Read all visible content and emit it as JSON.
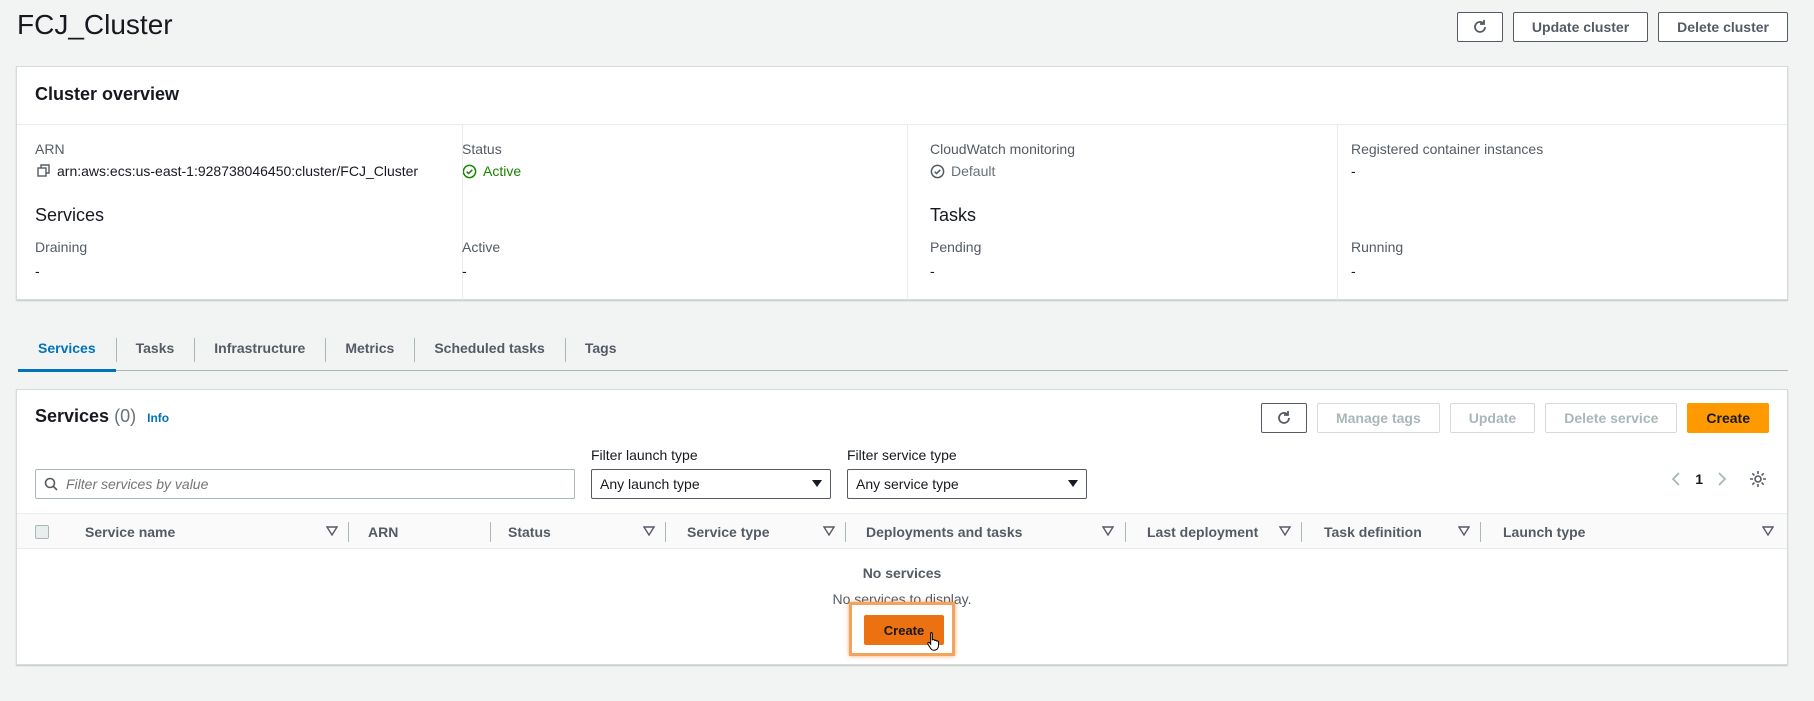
{
  "header": {
    "title": "FCJ_Cluster",
    "update_label": "Update cluster",
    "delete_label": "Delete cluster"
  },
  "overview": {
    "title": "Cluster overview",
    "arn_label": "ARN",
    "arn_value": "arn:aws:ecs:us-east-1:928738046450:cluster/FCJ_Cluster",
    "status_label": "Status",
    "status_value": "Active",
    "cloudwatch_label": "CloudWatch monitoring",
    "cloudwatch_value": "Default",
    "registered_label": "Registered container instances",
    "registered_value": "-",
    "services_title": "Services",
    "draining_label": "Draining",
    "draining_value": "-",
    "active_label": "Active",
    "active_value": "-",
    "tasks_title": "Tasks",
    "pending_label": "Pending",
    "pending_value": "-",
    "running_label": "Running",
    "running_value": "-"
  },
  "tabs": [
    {
      "label": "Services"
    },
    {
      "label": "Tasks"
    },
    {
      "label": "Infrastructure"
    },
    {
      "label": "Metrics"
    },
    {
      "label": "Scheduled tasks"
    },
    {
      "label": "Tags"
    }
  ],
  "services": {
    "title": "Services",
    "count": "(0)",
    "info": "Info",
    "manage_tags": "Manage tags",
    "update": "Update",
    "delete_service": "Delete service",
    "create": "Create",
    "search_placeholder": "Filter services by value",
    "filter_launch_label": "Filter launch type",
    "filter_launch_value": "Any launch type",
    "filter_service_label": "Filter service type",
    "filter_service_value": "Any service type",
    "page": "1",
    "columns": [
      "Service name",
      "ARN",
      "Status",
      "Service type",
      "Deployments and tasks",
      "Last deployment",
      "Task definition",
      "Launch type"
    ],
    "empty_title": "No services",
    "empty_desc": "No services to display.",
    "empty_create": "Create"
  },
  "colors": {
    "accent": "#0073bb",
    "primary": "#ff9900",
    "active_green": "#1d8102"
  }
}
